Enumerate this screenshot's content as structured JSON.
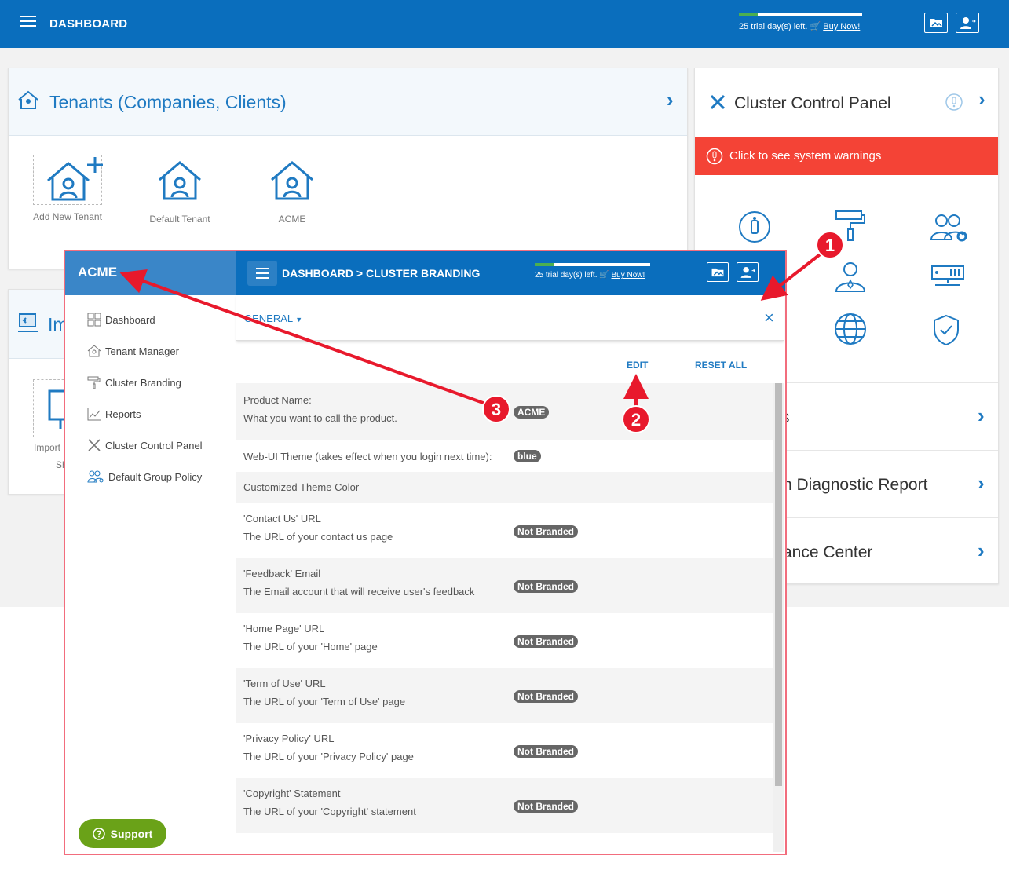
{
  "topbar": {
    "title": "DASHBOARD",
    "trial_text": "25 trial day(s) left.",
    "buy_now": "Buy Now!"
  },
  "tenants": {
    "title": "Tenants (Companies, Clients)",
    "tiles": [
      "Add New Tenant",
      "Default Tenant",
      "ACME"
    ]
  },
  "import_card": {
    "title_partial": "Im",
    "tile_label": "Import",
    "tile_sub": "Sh"
  },
  "cluster": {
    "title": "Cluster Control Panel",
    "warning": "Click to see system warnings",
    "rows": [
      "s",
      "n Diagnostic Report",
      "ance Center"
    ]
  },
  "overlay": {
    "sidebar": {
      "title": "ACME",
      "items": [
        "Dashboard",
        "Tenant Manager",
        "Cluster Branding",
        "Reports",
        "Cluster Control Panel",
        "Default Group Policy"
      ],
      "support": "Support"
    },
    "header": {
      "crumb": "DASHBOARD > CLUSTER BRANDING",
      "trial_text": "25 trial day(s) left.",
      "buy_now": "Buy Now!"
    },
    "tab": "GENERAL",
    "edit": "EDIT",
    "reset_all": "RESET ALL",
    "rows": [
      {
        "label": "Product Name:",
        "desc": "What you want to call the product.",
        "value": "ACME"
      },
      {
        "label": "Web-UI Theme (takes effect when you login next time):",
        "desc": "",
        "value": "blue"
      },
      {
        "label": "Customized Theme Color",
        "desc": "",
        "value": ""
      },
      {
        "label": "'Contact Us' URL",
        "desc": "The URL of your contact us page",
        "value": "Not Branded"
      },
      {
        "label": "'Feedback' Email",
        "desc": "The Email account that will receive user's feedback",
        "value": "Not Branded"
      },
      {
        "label": "'Home Page' URL",
        "desc": "The URL of your 'Home' page",
        "value": "Not Branded"
      },
      {
        "label": "'Term of Use' URL",
        "desc": "The URL of your 'Term of Use' page",
        "value": "Not Branded"
      },
      {
        "label": "'Privacy Policy' URL",
        "desc": "The URL of your 'Privacy Policy' page",
        "value": "Not Branded"
      },
      {
        "label": "'Copyright' Statement",
        "desc": "The URL of your 'Copyright' statement",
        "value": "Not Branded"
      }
    ]
  },
  "annotations": [
    "1",
    "2",
    "3"
  ],
  "colors": {
    "primary": "#0a6ebd",
    "accent": "#1f7ac2",
    "warning": "#f44336",
    "support": "#6aa218",
    "annotation": "#e8192c"
  }
}
